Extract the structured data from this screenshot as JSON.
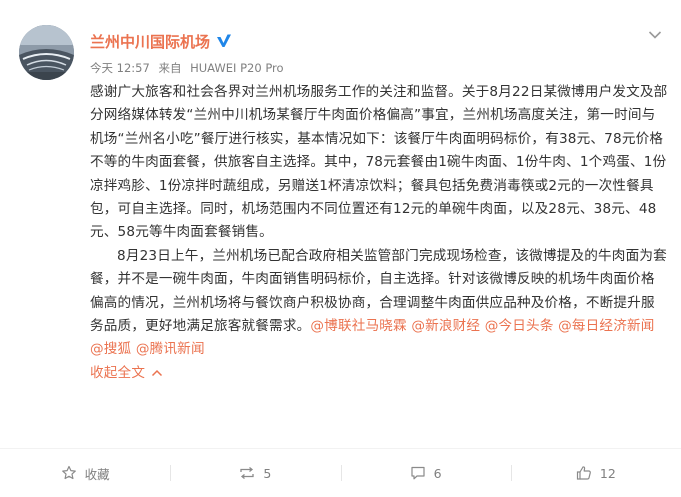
{
  "post": {
    "author": "兰州中川国际机场",
    "time": "今天 12:57",
    "source_prefix": "来自",
    "device": "HUAWEI P20 Pro",
    "paragraph1": "感谢广大旅客和社会各界对兰州机场服务工作的关注和监督。关于8月22日某微博用户发文及部分网络媒体转发“兰州中川机场某餐厅牛肉面价格偏高”事宜，兰州机场高度关注，第一时间与机场“兰州名小吃”餐厅进行核实，基本情况如下：该餐厅牛肉面明码标价，有38元、78元价格不等的牛肉面套餐，供旅客自主选择。其中，78元套餐由1碗牛肉面、1份牛肉、1个鸡蛋、1份凉拌鸡胗、1份凉拌时蔬组成，另赠送1杯清凉饮料；餐具包括免费消毒筷或2元的一次性餐具包，可自主选择。同时，机场范围内不同位置还有12元的单碗牛肉面，以及28元、38元、48元、58元等牛肉面套餐销售。",
    "paragraph2": "8月23日上午，兰州机场已配合政府相关监管部门完成现场检查，该微博提及的牛肉面为套餐，并不是一碗牛肉面，牛肉面销售明码标价，自主选择。针对该微博反映的机场牛肉面价格偏高的情况，兰州机场将与餐饮商户积极协商，合理调整牛肉面供应品种及价格，不断提升服务品质，更好地满足旅客就餐需求。",
    "mentions": [
      "@博联社马晓霖",
      "@新浪财经",
      "@今日头条",
      "@每日经济新闻",
      "@搜狐",
      "@腾讯新闻"
    ],
    "collapse_label": "收起全文"
  },
  "actions": {
    "favorite_label": "收藏",
    "repost_count": "5",
    "comment_count": "6",
    "like_count": "12"
  },
  "colors": {
    "accent": "#eb7350",
    "text": "#333333",
    "muted": "#808080",
    "verified": "#1f86e8"
  },
  "icons": [
    "verified-icon",
    "chevron-down-icon",
    "star-icon",
    "repost-icon",
    "comment-icon",
    "thumbs-up-icon",
    "chevron-up-icon"
  ]
}
